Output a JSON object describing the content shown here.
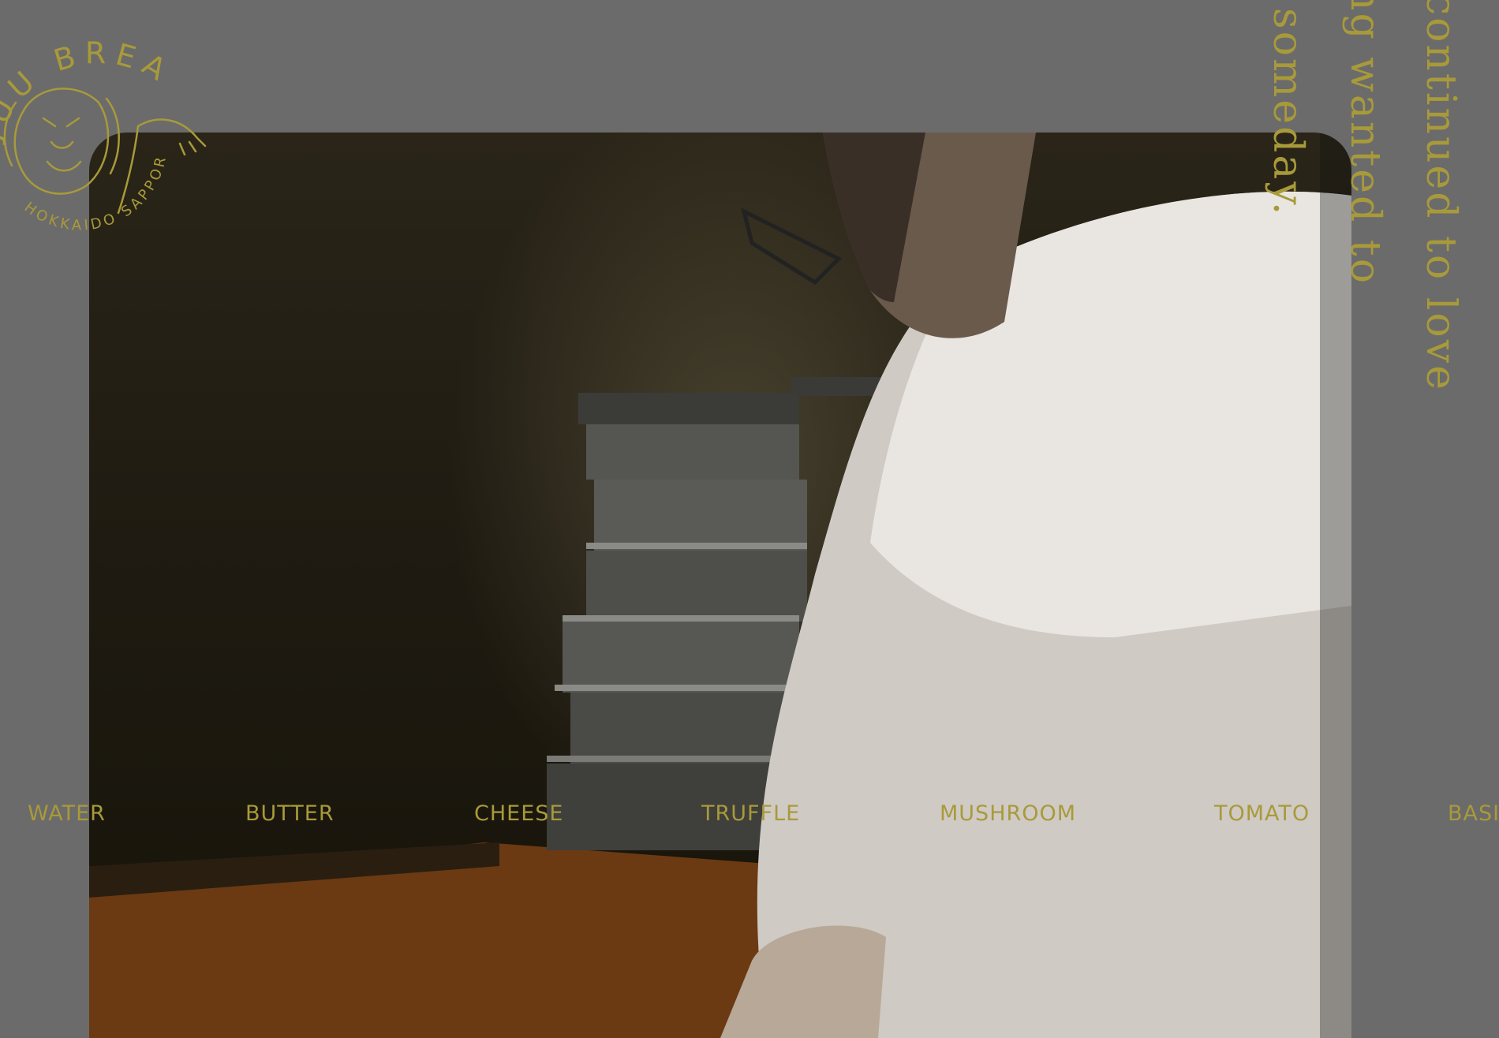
{
  "brand": {
    "logo_top_text": "JUU BREAD",
    "logo_bottom_text": "HOKKAIDO SAPPORO"
  },
  "tagline": {
    "line1": "continued to love",
    "line2": "ng wanted to",
    "line3": "someday."
  },
  "ingredients": [
    "WATER",
    "BUTTER",
    "CHEESE",
    "TRUFFLE",
    "MUSHROOM",
    "TOMATO",
    "BASI"
  ],
  "colors": {
    "background": "#6b6b6b",
    "accent_gold": "#a89a3a"
  }
}
